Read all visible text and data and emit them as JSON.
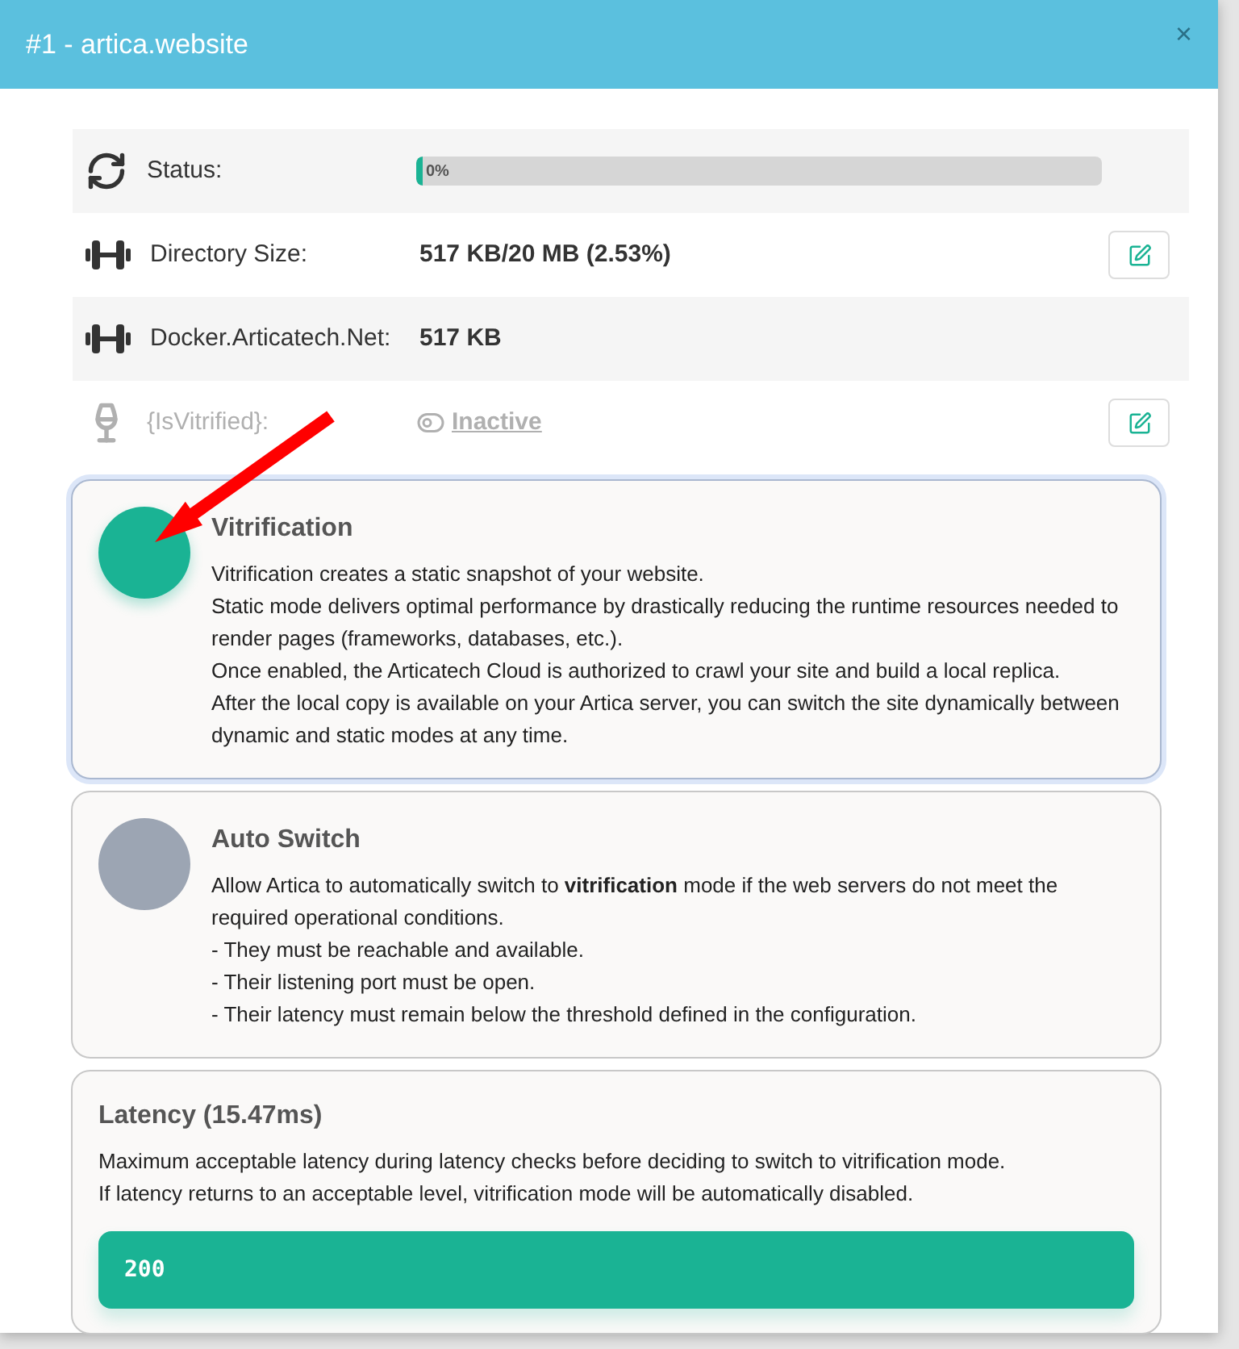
{
  "window": {
    "title": "#1 - artica.website",
    "close": "×"
  },
  "rows": [
    {
      "kind": "progress",
      "label": "Status:",
      "level": 0.01,
      "reading": "0%",
      "disabled": false,
      "editable": false
    },
    {
      "kind": "text",
      "label": "Directory Size:",
      "value": "517 KB/20 MB (2.53%)",
      "disabled": false,
      "editable": true
    },
    {
      "kind": "text",
      "label": "Docker.Articatech.Net:",
      "value": "517 KB",
      "disabled": false,
      "editable": false
    },
    {
      "kind": "toggle",
      "label": "{IsVitrified}:",
      "value": "Inactive",
      "on": false,
      "disabled": true,
      "editable": true
    }
  ],
  "options": [
    {
      "title": "Vitrification",
      "on": true,
      "selected": true,
      "lines": [
        "Vitrification creates a static snapshot of your website.",
        "Static mode delivers optimal performance by drastically reducing the runtime resources needed to render pages (frameworks, databases, etc.).",
        "Once enabled, the Articatech Cloud is authorized to crawl your site and build a local replica.",
        "After the local copy is available on your Artica server, you can switch the site dynamically between dynamic and static modes at any time."
      ]
    },
    {
      "title": "Auto Switch",
      "on": false,
      "selected": false,
      "lines": [
        "Allow Artica to automatically switch to **vitrification** mode if the web servers do not meet the required operational conditions.",
        "- They must be reachable and available.",
        "- Their listening port must be open.",
        "- Their latency must remain below the threshold defined in the configuration."
      ]
    }
  ],
  "latency": {
    "title": "Latency (15.47ms)",
    "lines": [
      "Maximum acceptable latency during latency checks before deciding to switch to vitrification mode.",
      "If latency returns to an acceptable level, vitrification mode will be automatically disabled."
    ],
    "value": "200"
  }
}
